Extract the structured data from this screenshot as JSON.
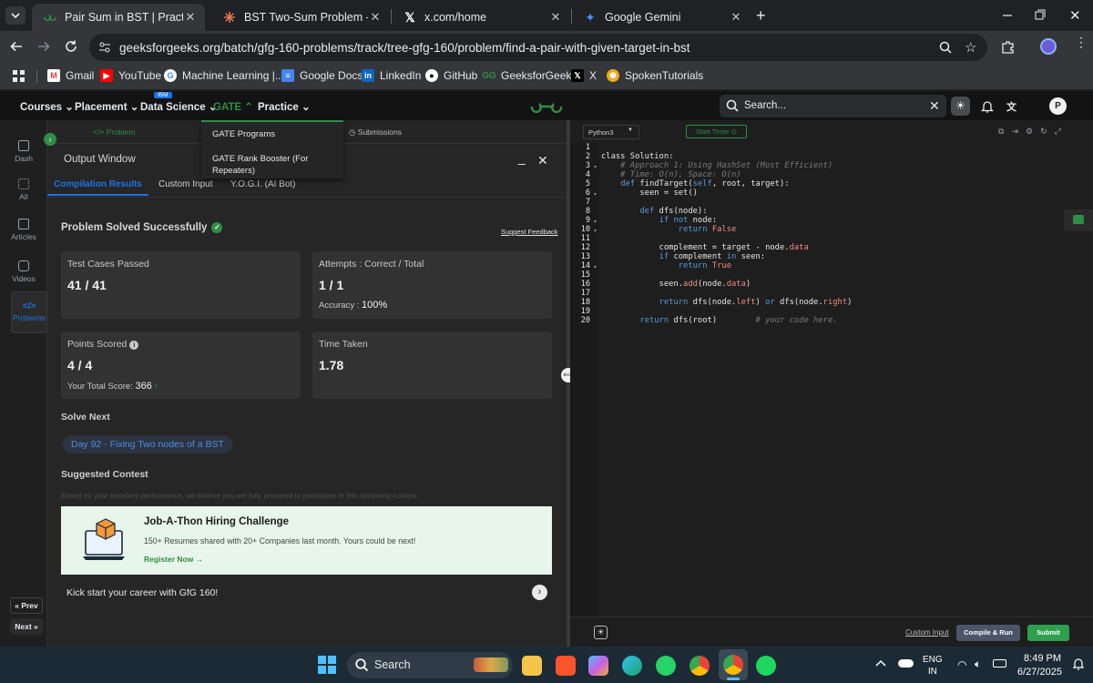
{
  "tabs": [
    {
      "title": "Pair Sum in BST | Practice | Gee",
      "favicon": "gfg-icon",
      "active": true
    },
    {
      "title": "BST Two-Sum Problem - Claude",
      "favicon": "claude-icon",
      "active": false
    },
    {
      "title": "x.com/home",
      "favicon": "x-icon",
      "active": false
    },
    {
      "title": "Google Gemini",
      "favicon": "gemini-icon",
      "active": false
    }
  ],
  "address_bar": {
    "url": "geeksforgeeks.org/batch/gfg-160-problems/track/tree-gfg-160/problem/find-a-pair-with-given-target-in-bst"
  },
  "bookmarks": [
    "Gmail",
    "YouTube",
    "Machine Learning |...",
    "Google Docs",
    "LinkedIn",
    "GitHub",
    "GeeksforGeeks",
    "X",
    "SpokenTutorials"
  ],
  "site_nav": {
    "items": [
      "Courses",
      "Placement",
      "Data Science",
      "GATE",
      "Practice"
    ],
    "ibm_badge": "IBM",
    "search_placeholder": "Search...",
    "avatar_letter": "P",
    "gate_menu": [
      "GATE Programs",
      "GATE Rank Booster (For Repeaters)"
    ]
  },
  "rail": {
    "items": [
      "Dash",
      "All",
      "Articles",
      "Videos",
      "Problems"
    ],
    "prev": "Prev",
    "next": "Next"
  },
  "problem_tabs": {
    "problem": "Problem",
    "submissions": "Submissions"
  },
  "output_window": {
    "title": "Output Window",
    "tabs": [
      "Compilation Results",
      "Custom Input",
      "Y.O.G.I. (AI Bot)"
    ],
    "status": "Problem Solved Successfully",
    "suggest_feedback": "Suggest Feedback",
    "stats": {
      "test_cases_label": "Test Cases Passed",
      "test_cases_value": "41 / 41",
      "attempts_label": "Attempts : Correct / Total",
      "attempts_value": "1 / 1",
      "accuracy_label": "Accuracy :",
      "accuracy_value": "100%",
      "points_label": "Points Scored",
      "points_value": "4 / 4",
      "total_score_label": "Your Total Score:",
      "total_score_value": "366",
      "time_label": "Time Taken",
      "time_value": "1.78"
    },
    "solve_next_label": "Solve Next",
    "solve_next_item": "Day 92 - Fixing Two nodes of a BST",
    "contest_label": "Suggested Contest",
    "contest_desc": "Based on your excellent performance, we believe you are fully prepared to participate in this upcoming contest.",
    "contest_title": "Job-A-Thon Hiring Challenge",
    "contest_sub": "150+ Resumes shared with 20+ Companies last month. Yours could be next!",
    "register": "Register Now →",
    "kickstart": "Kick start your career with GfG 160!"
  },
  "editor": {
    "language": "Python3",
    "start_timer": "Start Timer",
    "line_numbers": [
      "1",
      "2",
      "3",
      "4",
      "5",
      "6",
      "7",
      "8",
      "9",
      "10",
      "11",
      "12",
      "13",
      "14",
      "15",
      "16",
      "17",
      "18",
      "19",
      "20"
    ],
    "custom_input": "Custom Input",
    "compile_run": "Compile & Run",
    "submit": "Submit"
  },
  "taskbar": {
    "search": "Search",
    "lang_top": "ENG",
    "lang_bottom": "IN",
    "time": "8:49 PM",
    "date": "6/27/2025"
  },
  "colors": {
    "gfg_green": "#2f8d46",
    "accent_blue": "#1a73e8",
    "submit_green": "#2e9e4f"
  }
}
